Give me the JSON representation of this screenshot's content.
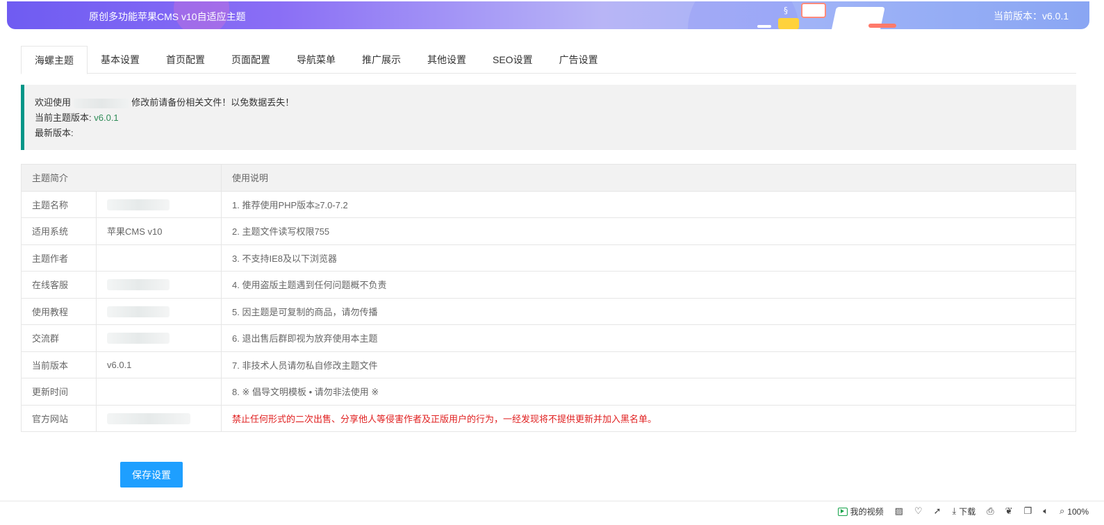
{
  "header": {
    "title": "原创多功能苹果CMS v10自适应主题",
    "version_text": "当前版本：v6.0.1"
  },
  "tabs": [
    {
      "label": "海螺主题",
      "active": true
    },
    {
      "label": "基本设置",
      "active": false
    },
    {
      "label": "首页配置",
      "active": false
    },
    {
      "label": "页面配置",
      "active": false
    },
    {
      "label": "导航菜单",
      "active": false
    },
    {
      "label": "推广展示",
      "active": false
    },
    {
      "label": "其他设置",
      "active": false
    },
    {
      "label": "SEO设置",
      "active": false
    },
    {
      "label": "广告设置",
      "active": false
    }
  ],
  "notice": {
    "welcome_prefix": "欢迎使用",
    "welcome_suffix": "修改前请备份相关文件！以免数据丢失！",
    "current_version_label": "当前主题版本:",
    "current_version_value": "v6.0.1",
    "latest_version_label": "最新版本:"
  },
  "table": {
    "headers": [
      "主题简介",
      "使用说明"
    ],
    "rows": [
      {
        "label": "主题名称",
        "value": "",
        "note": "1. 推荐使用PHP版本≥7.0-7.2"
      },
      {
        "label": "适用系统",
        "value": "苹果CMS v10",
        "note": "2. 主题文件读写权限755"
      },
      {
        "label": "主题作者",
        "value": "",
        "note": "3. 不支持IE8及以下浏览器"
      },
      {
        "label": "在线客服",
        "value": "",
        "note": "4. 使用盗版主题遇到任何问题概不负责"
      },
      {
        "label": "使用教程",
        "value": "",
        "note": "5. 因主题是可复制的商品，请勿传播"
      },
      {
        "label": "交流群",
        "value": "",
        "note": "6. 退出售后群即视为放弃使用本主题"
      },
      {
        "label": "当前版本",
        "value": "v6.0.1",
        "note": "7. 非技术人员请勿私自修改主题文件"
      },
      {
        "label": "更新时间",
        "value": "",
        "note": "8. ※ 倡导文明模板 • 请勿非法使用 ※"
      },
      {
        "label": "官方网站",
        "value": "",
        "note": "禁止任何形式的二次出售、分享他人等侵害作者及正版用户的行为，一经发现将不提供更新并加入黑名单。"
      }
    ]
  },
  "save_button": "保存设置",
  "statusbar": {
    "my_video": "我的视频",
    "download": "下载",
    "zoom": "100%"
  },
  "colors": {
    "accent_blue": "#1e9fff",
    "notice_border": "#009688",
    "warning_red": "#e02020",
    "version_green": "#2e8b57"
  }
}
